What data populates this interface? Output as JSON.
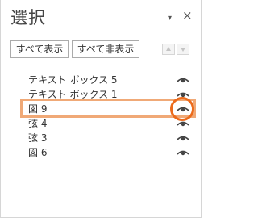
{
  "pane": {
    "title": "選択",
    "dropdown_glyph": "▾",
    "close_glyph": "×"
  },
  "toolbar": {
    "show_all_label": "すべて表示",
    "hide_all_label": "すべて非表示"
  },
  "items": [
    {
      "label": "テキスト ボックス 5",
      "visible": true,
      "selected": false
    },
    {
      "label": "テキスト ボックス 1",
      "visible": true,
      "selected": false
    },
    {
      "label": "図 9",
      "visible": true,
      "selected": true
    },
    {
      "label": "弦 4",
      "visible": true,
      "selected": false
    },
    {
      "label": "弦 3",
      "visible": true,
      "selected": false
    },
    {
      "label": "図 6",
      "visible": true,
      "selected": false
    }
  ],
  "icons": {
    "visibility": "eye-icon",
    "move_up": "triangle-up-icon",
    "move_down": "triangle-down-icon"
  },
  "colors": {
    "highlight_rect": "#f0a977",
    "highlight_circle": "#ec6b1c",
    "eye": "#444444"
  }
}
